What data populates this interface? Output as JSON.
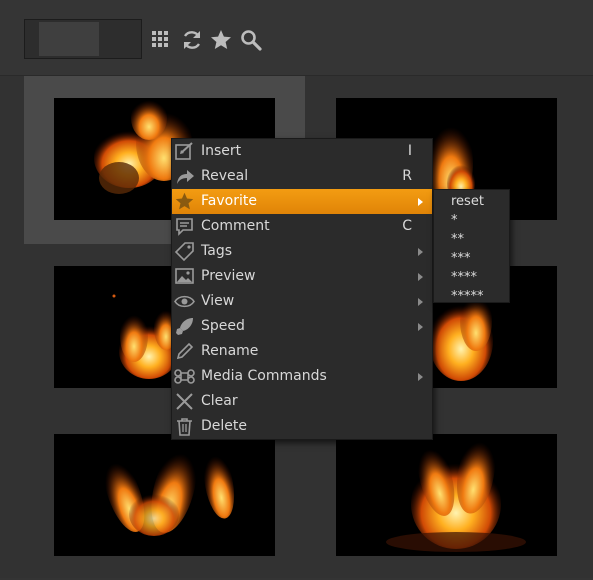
{
  "toolbar": {
    "icons": [
      "grid-icon",
      "refresh-icon",
      "star-icon",
      "search-icon"
    ]
  },
  "colors": {
    "accent": "#f39c12",
    "menu_bg": "#2b2b2b",
    "toolbar_bg": "#353535",
    "grid_bg": "#323232",
    "selected_cell": "#4a4a4a"
  },
  "context_menu": {
    "items": [
      {
        "label": "Insert",
        "shortcut": "I",
        "icon": "insert-icon",
        "submenu": false
      },
      {
        "label": "Reveal",
        "shortcut": "R",
        "icon": "reveal-arrow-icon",
        "submenu": false
      },
      {
        "label": "Favorite",
        "shortcut": "",
        "icon": "star-icon",
        "submenu": true,
        "highlighted": true
      },
      {
        "label": "Comment",
        "shortcut": "C",
        "icon": "comment-icon",
        "submenu": false
      },
      {
        "label": "Tags",
        "shortcut": "",
        "icon": "tag-icon",
        "submenu": true
      },
      {
        "label": "Preview",
        "shortcut": "",
        "icon": "image-icon",
        "submenu": true
      },
      {
        "label": "View",
        "shortcut": "",
        "icon": "eye-icon",
        "submenu": true
      },
      {
        "label": "Speed",
        "shortcut": "",
        "icon": "rocket-icon",
        "submenu": true
      },
      {
        "label": "Rename",
        "shortcut": "",
        "icon": "pencil-icon",
        "submenu": false
      },
      {
        "label": "Media Commands",
        "shortcut": "",
        "icon": "command-icon",
        "submenu": true
      },
      {
        "label": "Clear",
        "shortcut": "",
        "icon": "x-icon",
        "submenu": false
      },
      {
        "label": "Delete",
        "shortcut": "",
        "icon": "trash-icon",
        "submenu": false
      }
    ]
  },
  "favorite_submenu": {
    "items": [
      "reset",
      "*",
      "**",
      "***",
      "****",
      "*****"
    ]
  },
  "thumbnails": [
    {
      "icon": "fire-thumbnail",
      "selected": true
    },
    {
      "icon": "fire-thumbnail",
      "selected": false
    },
    {
      "icon": "fire-thumbnail",
      "selected": false
    },
    {
      "icon": "fire-thumbnail",
      "selected": false
    },
    {
      "icon": "fire-thumbnail",
      "selected": false
    },
    {
      "icon": "fire-thumbnail",
      "selected": false
    }
  ]
}
